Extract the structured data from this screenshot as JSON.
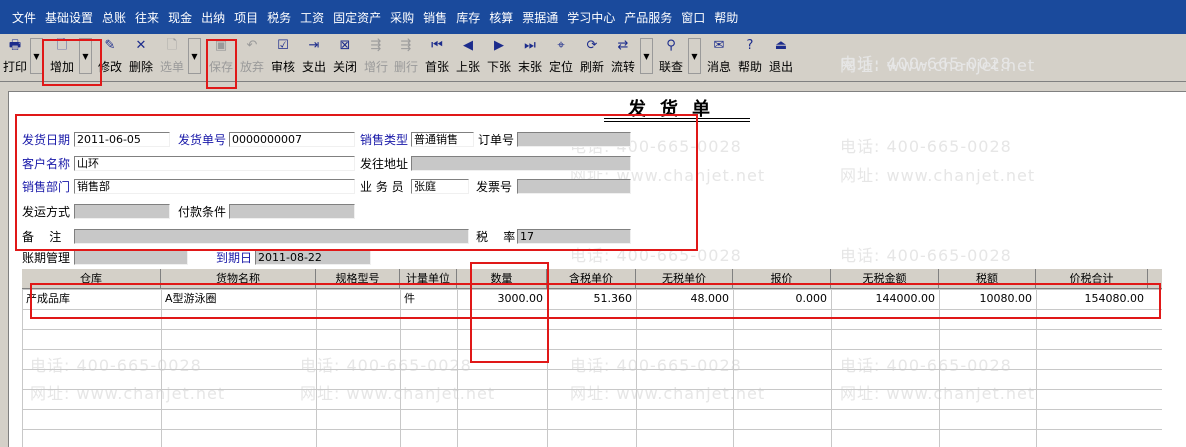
{
  "menu": [
    "文件",
    "基础设置",
    "总账",
    "往来",
    "现金",
    "出纳",
    "项目",
    "税务",
    "工资",
    "固定资产",
    "采购",
    "销售",
    "库存",
    "核算",
    "票据通",
    "学习中心",
    "产品服务",
    "窗口",
    "帮助"
  ],
  "toolbar": {
    "print": "打印",
    "add": "增加",
    "modify": "修改",
    "delete": "删除",
    "select": "选单",
    "save": "保存",
    "abandon": "放弃",
    "audit": "审核",
    "pay": "支出",
    "close": "关闭",
    "add_row": "增行",
    "del_row": "删行",
    "first": "首张",
    "prev": "上张",
    "next": "下张",
    "last": "末张",
    "locate": "定位",
    "refresh": "刷新",
    "flow": "流转",
    "query": "联查",
    "message": "消息",
    "help": "帮助",
    "exit": "退出"
  },
  "form": {
    "title": "发货单",
    "date_label": "发货日期",
    "date": "2011-06-05",
    "no_label": "发货单号",
    "no": "0000000007",
    "type_label": "销售类型",
    "type": "普通销售",
    "order_label": "订单号",
    "order": "",
    "customer_label": "客户名称",
    "customer": "山环",
    "addr_label": "发往地址",
    "addr": "",
    "dept_label": "销售部门",
    "dept": "销售部",
    "staff_label": "业 务 员",
    "staff": "张庭",
    "invoice_label": "发票号",
    "invoice": "",
    "ship_label": "发运方式",
    "ship": "",
    "terms_label": "付款条件",
    "terms": "",
    "note_label": "备    注",
    "note": "",
    "tax_label": "税    率",
    "tax": "17",
    "acct_label": "账期管理",
    "acct": "",
    "due_label": "到期日",
    "due": "2011-08-22"
  },
  "grid": {
    "columns": [
      "仓库",
      "货物名称",
      "规格型号",
      "计量单位",
      "数量",
      "含税单价",
      "无税单价",
      "报价",
      "无税金额",
      "税额",
      "价税合计"
    ],
    "rows": [
      {
        "warehouse": "产成品库",
        "goods": "A型游泳圈",
        "spec": "",
        "unit": "件",
        "qty": "3000.00",
        "price_tax": "51.360",
        "price": "48.000",
        "quote": "0.000",
        "amount": "144000.00",
        "tax": "10080.00",
        "total": "154080.00"
      }
    ]
  },
  "watermark": {
    "phone": "电话: 400-665-0028",
    "site": "网址: www.chanjet.net"
  }
}
